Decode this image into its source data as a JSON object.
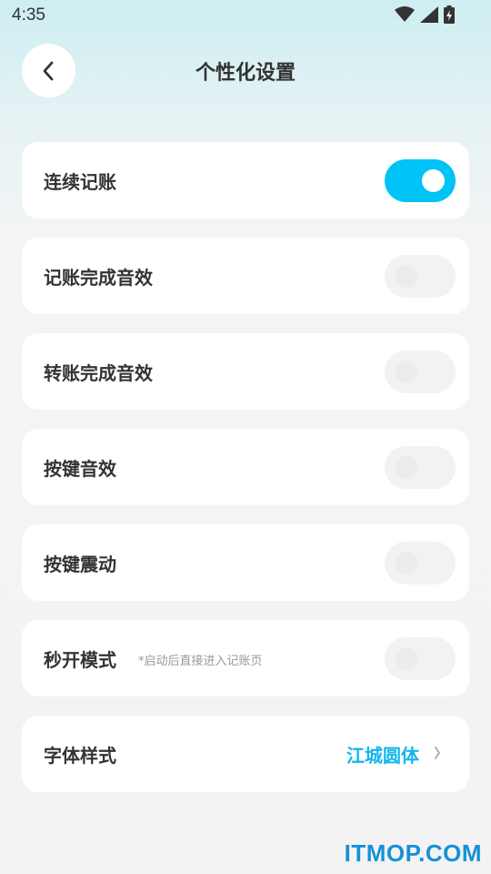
{
  "status_bar": {
    "time": "4:35",
    "icons": [
      "wifi-icon",
      "cellular-signal-icon",
      "battery-charging-icon"
    ]
  },
  "header": {
    "back_icon": "chevron-left-icon",
    "title": "个性化设置"
  },
  "settings": {
    "items": [
      {
        "label": "连续记账",
        "toggle": true
      },
      {
        "label": "记账完成音效",
        "toggle": false
      },
      {
        "label": "转账完成音效",
        "toggle": false
      },
      {
        "label": "按键音效",
        "toggle": false
      },
      {
        "label": "按键震动",
        "toggle": false
      },
      {
        "label": "秒开模式",
        "sublabel": "*启动后直接进入记账页",
        "toggle": false
      }
    ],
    "font_style": {
      "label": "字体样式",
      "value": "江城圆体",
      "icon": "chevron-right-icon"
    }
  },
  "colors": {
    "accent": "#00c3f6",
    "value_text": "#12b6ec",
    "watermark": "#1591d6"
  },
  "watermark": "ITMOP.COM"
}
